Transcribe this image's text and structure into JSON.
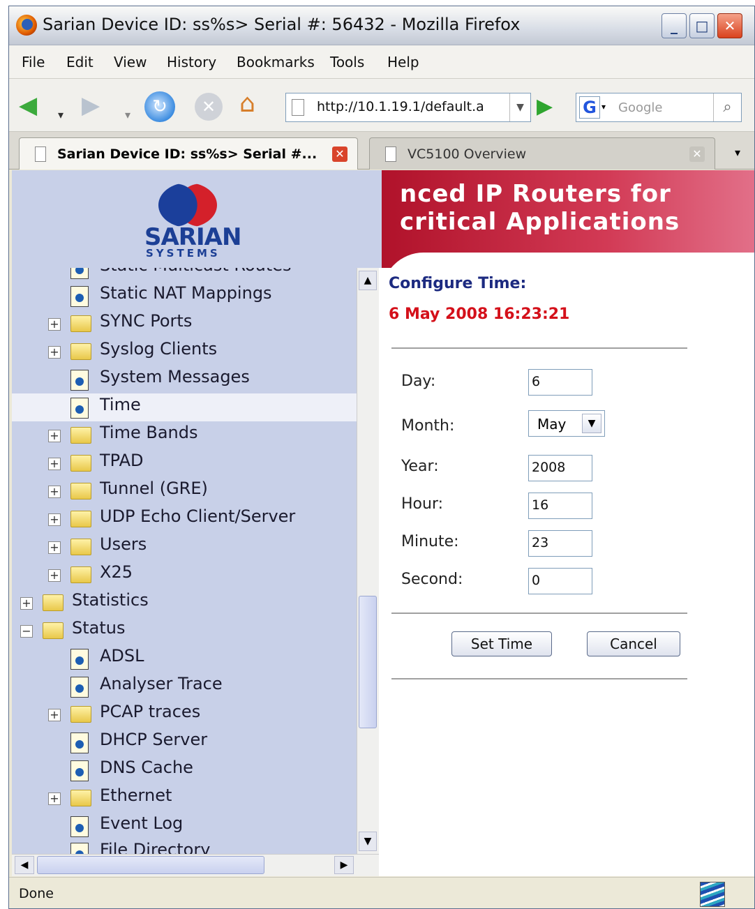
{
  "window": {
    "title": "Sarian Device ID: ss%s> Serial #: 56432 - Mozilla Firefox"
  },
  "menu": [
    "File",
    "Edit",
    "View",
    "History",
    "Bookmarks",
    "Tools",
    "Help"
  ],
  "nav": {
    "url": "http://10.1.19.1/default.a",
    "search_placeholder": "Google"
  },
  "tabs": [
    {
      "label": "Sarian Device ID: ss%s> Serial #...",
      "active": true
    },
    {
      "label": "VC5100 Overview",
      "active": false
    }
  ],
  "banner": {
    "logo": "SARIAN",
    "logo_sub": "SYSTEMS",
    "tagline_1": "nced IP Routers for",
    "tagline_2": "critical Applications"
  },
  "tree": [
    {
      "label": "Static Multicast Routes",
      "icon": "page-icon"
    },
    {
      "label": "Static NAT Mappings",
      "icon": "page-icon"
    },
    {
      "label": "SYNC Ports",
      "icon": "folder-icon"
    },
    {
      "label": "Syslog Clients",
      "icon": "folder-icon"
    },
    {
      "label": "System Messages",
      "icon": "page-icon"
    },
    {
      "label": "Time",
      "icon": "page-icon",
      "selected": true
    },
    {
      "label": "Time Bands",
      "icon": "folder-icon"
    },
    {
      "label": "TPAD",
      "icon": "folder-icon"
    },
    {
      "label": "Tunnel (GRE)",
      "icon": "folder-icon"
    },
    {
      "label": "UDP Echo Client/Server",
      "icon": "folder-icon"
    },
    {
      "label": "Users",
      "icon": "folder-icon"
    },
    {
      "label": "X25",
      "icon": "folder-icon"
    },
    {
      "label": "Statistics",
      "icon": "folder-icon"
    },
    {
      "label": "Status",
      "icon": "open-folder-icon"
    },
    {
      "label": "ADSL",
      "icon": "page-icon"
    },
    {
      "label": "Analyser Trace",
      "icon": "page-icon"
    },
    {
      "label": "PCAP traces",
      "icon": "folder-icon"
    },
    {
      "label": "DHCP Server",
      "icon": "page-icon"
    },
    {
      "label": "DNS Cache",
      "icon": "page-icon"
    },
    {
      "label": "Ethernet",
      "icon": "folder-icon"
    },
    {
      "label": "Event Log",
      "icon": "page-icon"
    },
    {
      "label": "File Directory",
      "icon": "page-icon"
    }
  ],
  "form": {
    "title": "Configure Time:",
    "current": "6 May 2008 16:23:21",
    "labels": {
      "day": "Day:",
      "month": "Month:",
      "year": "Year:",
      "hour": "Hour:",
      "minute": "Minute:",
      "second": "Second:"
    },
    "values": {
      "day": "6",
      "month": "May",
      "year": "2008",
      "hour": "16",
      "minute": "23",
      "second": "0"
    },
    "set_label": "Set Time",
    "cancel_label": "Cancel"
  },
  "status": {
    "text": "Done"
  }
}
